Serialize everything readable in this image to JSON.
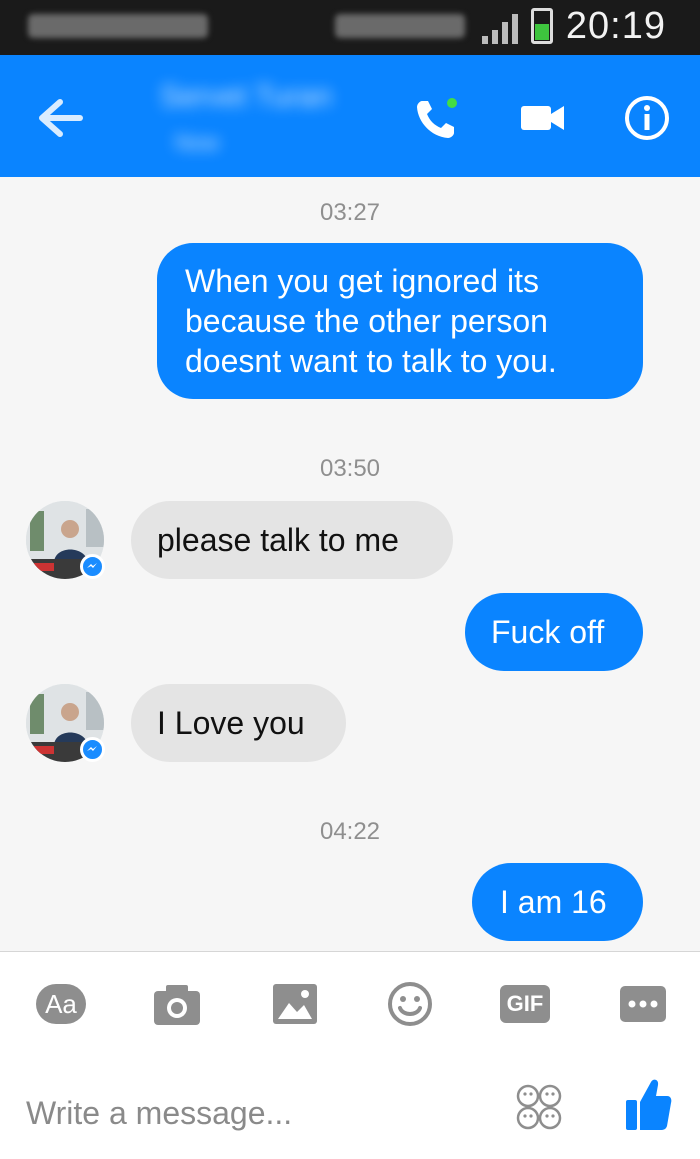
{
  "status_bar": {
    "time": "20:19"
  },
  "header": {
    "contact_name": "Servet Turan",
    "contact_status": "Now"
  },
  "messages": [
    {
      "type": "timestamp",
      "text": "03:27"
    },
    {
      "type": "outgoing",
      "text": "When you get ignored its because the other person doesnt want to talk to you."
    },
    {
      "type": "timestamp",
      "text": "03:50"
    },
    {
      "type": "incoming",
      "text": "please talk to me"
    },
    {
      "type": "outgoing",
      "text": "Fuck off"
    },
    {
      "type": "incoming",
      "text": "I Love you"
    },
    {
      "type": "timestamp",
      "text": "04:22"
    },
    {
      "type": "outgoing",
      "text": "I am 16"
    }
  ],
  "toolbar": {
    "text_button_label": "Aa",
    "gif_label": "GIF"
  },
  "composer": {
    "placeholder": "Write a message..."
  },
  "colors": {
    "accent": "#0a84ff",
    "incoming_bubble": "#e4e4e4",
    "background": "#f6f6f6"
  },
  "icons": [
    "back-arrow-icon",
    "phone-icon",
    "video-camera-icon",
    "info-icon",
    "camera-icon",
    "image-icon",
    "emoji-icon",
    "gif-icon",
    "more-icon",
    "stickers-icon",
    "thumbs-up-icon"
  ]
}
